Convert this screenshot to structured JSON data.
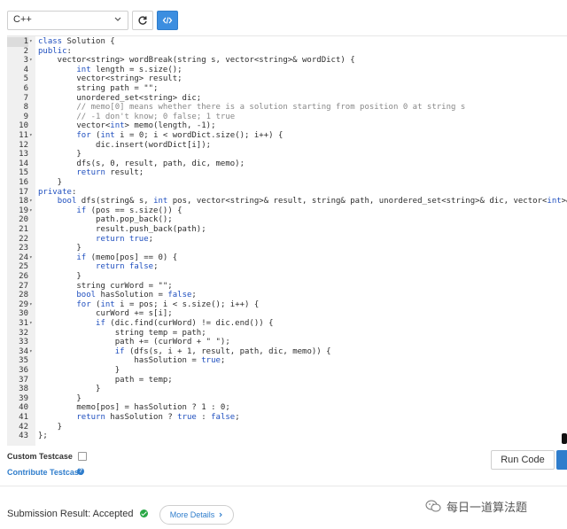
{
  "toolbar": {
    "language": "C++"
  },
  "editor": {
    "lines": [
      {
        "n": "1",
        "fold": true,
        "code": "class Solution {"
      },
      {
        "n": "2",
        "fold": false,
        "code": "public:"
      },
      {
        "n": "3",
        "fold": true,
        "code": "    vector<string> wordBreak(string s, vector<string>& wordDict) {"
      },
      {
        "n": "4",
        "fold": false,
        "code": "        int length = s.size();"
      },
      {
        "n": "5",
        "fold": false,
        "code": "        vector<string> result;"
      },
      {
        "n": "6",
        "fold": false,
        "code": "        string path = \"\";"
      },
      {
        "n": "7",
        "fold": false,
        "code": "        unordered_set<string> dic;"
      },
      {
        "n": "8",
        "fold": false,
        "code": "        // memo[0] means whether there is a solution starting from position 0 at string s"
      },
      {
        "n": "9",
        "fold": false,
        "code": "        // -1 don't know; 0 false; 1 true"
      },
      {
        "n": "10",
        "fold": false,
        "code": "        vector<int> memo(length, -1);"
      },
      {
        "n": "11",
        "fold": true,
        "code": "        for (int i = 0; i < wordDict.size(); i++) {"
      },
      {
        "n": "12",
        "fold": false,
        "code": "            dic.insert(wordDict[i]);"
      },
      {
        "n": "13",
        "fold": false,
        "code": "        }"
      },
      {
        "n": "14",
        "fold": false,
        "code": "        dfs(s, 0, result, path, dic, memo);"
      },
      {
        "n": "15",
        "fold": false,
        "code": "        return result;"
      },
      {
        "n": "16",
        "fold": false,
        "code": "    }"
      },
      {
        "n": "17",
        "fold": false,
        "code": "private:"
      },
      {
        "n": "18",
        "fold": true,
        "code": "    bool dfs(string& s, int pos, vector<string>& result, string& path, unordered_set<string>& dic, vector<int>& memo) {"
      },
      {
        "n": "19",
        "fold": true,
        "code": "        if (pos == s.size()) {"
      },
      {
        "n": "20",
        "fold": false,
        "code": "            path.pop_back();"
      },
      {
        "n": "21",
        "fold": false,
        "code": "            result.push_back(path);"
      },
      {
        "n": "22",
        "fold": false,
        "code": "            return true;"
      },
      {
        "n": "23",
        "fold": false,
        "code": "        }"
      },
      {
        "n": "24",
        "fold": true,
        "code": "        if (memo[pos] == 0) {"
      },
      {
        "n": "25",
        "fold": false,
        "code": "            return false;"
      },
      {
        "n": "26",
        "fold": false,
        "code": "        }"
      },
      {
        "n": "27",
        "fold": false,
        "code": "        string curWord = \"\";"
      },
      {
        "n": "28",
        "fold": false,
        "code": "        bool hasSolution = false;"
      },
      {
        "n": "29",
        "fold": true,
        "code": "        for (int i = pos; i < s.size(); i++) {"
      },
      {
        "n": "30",
        "fold": false,
        "code": "            curWord += s[i];"
      },
      {
        "n": "31",
        "fold": true,
        "code": "            if (dic.find(curWord) != dic.end()) {"
      },
      {
        "n": "32",
        "fold": false,
        "code": "                string temp = path;"
      },
      {
        "n": "33",
        "fold": false,
        "code": "                path += (curWord + \" \");"
      },
      {
        "n": "34",
        "fold": true,
        "code": "                if (dfs(s, i + 1, result, path, dic, memo)) {"
      },
      {
        "n": "35",
        "fold": false,
        "code": "                    hasSolution = true;"
      },
      {
        "n": "36",
        "fold": false,
        "code": "                }"
      },
      {
        "n": "37",
        "fold": false,
        "code": "                path = temp;"
      },
      {
        "n": "38",
        "fold": false,
        "code": "            }"
      },
      {
        "n": "39",
        "fold": false,
        "code": "        }"
      },
      {
        "n": "40",
        "fold": false,
        "code": "        memo[pos] = hasSolution ? 1 : 0;"
      },
      {
        "n": "41",
        "fold": false,
        "code": "        return hasSolution ? true : false;"
      },
      {
        "n": "42",
        "fold": false,
        "code": "    }"
      },
      {
        "n": "43",
        "fold": false,
        "code": "};"
      }
    ]
  },
  "testcase": {
    "custom_label": "Custom Testcase",
    "contribute_label": "Contribute Testcase"
  },
  "actions": {
    "run_label": "Run Code"
  },
  "submission": {
    "label": "Submission Result:",
    "status": "Accepted",
    "more_label": "More Details"
  },
  "watermark": {
    "text": "每日一道算法题"
  },
  "colors": {
    "accent": "#3c8ee0",
    "success": "#28a745",
    "keyword": "#1f4fbf",
    "comment": "#888888"
  }
}
